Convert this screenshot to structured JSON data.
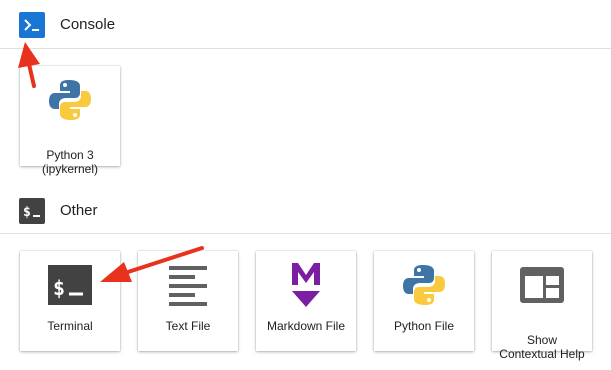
{
  "sections": {
    "console": {
      "title": "Console",
      "icon": "console-prompt-icon",
      "icon_bg": "#1976d2",
      "cards": [
        {
          "label": "Python 3\n(ipykernel)",
          "icon": "python-logo-icon"
        }
      ]
    },
    "other": {
      "title": "Other",
      "icon": "terminal-dollar-icon",
      "icon_bg": "#424242",
      "cards": [
        {
          "label": "Terminal",
          "icon": "terminal-icon"
        },
        {
          "label": "Text File",
          "icon": "text-file-icon"
        },
        {
          "label": "Markdown File",
          "icon": "markdown-icon"
        },
        {
          "label": "Python File",
          "icon": "python-logo-icon"
        },
        {
          "label": "Show\nContextual Help",
          "icon": "contextual-help-icon"
        }
      ]
    }
  },
  "colors": {
    "annotation_arrow": "#e8321e",
    "markdown": "#7b1fa2",
    "python_blue": "#3e74a6",
    "python_yellow": "#f9c93e",
    "icon_gray": "#616161"
  }
}
